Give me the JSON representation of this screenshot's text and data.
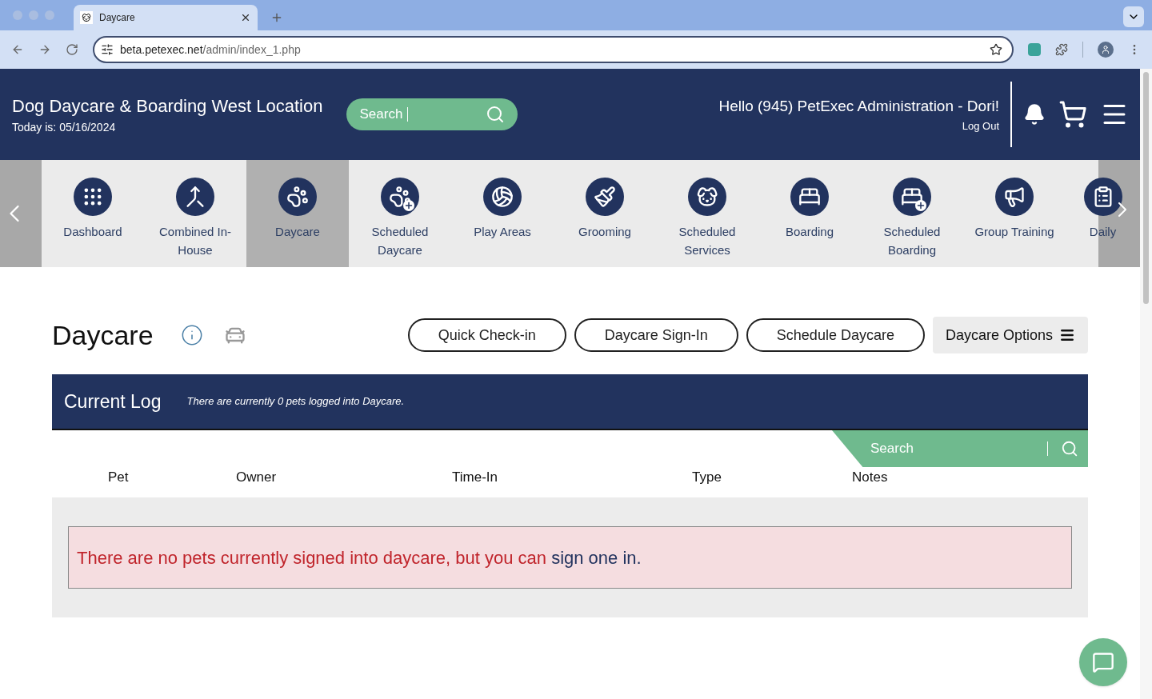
{
  "browser": {
    "tab_title": "Daycare",
    "url_host": "beta.petexec.net",
    "url_path": "/admin/index_1.php"
  },
  "header": {
    "title": "Dog Daycare & Boarding West Location",
    "date": "Today is: 05/16/2024",
    "search": {
      "placeholder": "Search"
    },
    "greeting": "Hello (945) PetExec Administration - Dori!",
    "logout": "Log Out"
  },
  "nav": [
    {
      "label": "Dashboard",
      "kind": "dashboard",
      "selected": false
    },
    {
      "label": "Combined In-House",
      "kind": "combined",
      "selected": false
    },
    {
      "label": "Daycare",
      "kind": "daycare",
      "selected": true
    },
    {
      "label": "Scheduled Daycare",
      "kind": "scheduled_daycare",
      "selected": false
    },
    {
      "label": "Play Areas",
      "kind": "play",
      "selected": false
    },
    {
      "label": "Grooming",
      "kind": "grooming",
      "selected": false
    },
    {
      "label": "Scheduled Services",
      "kind": "services",
      "selected": false
    },
    {
      "label": "Boarding",
      "kind": "boarding",
      "selected": false
    },
    {
      "label": "Scheduled Boarding",
      "kind": "scheduled_boarding",
      "selected": false
    },
    {
      "label": "Group Training",
      "kind": "training",
      "selected": false
    },
    {
      "label": "Daily",
      "kind": "daily",
      "selected": false
    }
  ],
  "page": {
    "title": "Daycare",
    "actions": [
      "Quick Check-in",
      "Daycare Sign-In",
      "Schedule Daycare"
    ],
    "options": "Daycare Options"
  },
  "log": {
    "title": "Current Log",
    "subtitle": "There are currently 0 pets logged into Daycare.",
    "search": {
      "placeholder": "Search"
    },
    "columns": [
      "Pet",
      "Owner",
      "Time-In",
      "Type",
      "Notes"
    ],
    "empty_message": "There are no pets currently signed into daycare, but you can",
    "empty_link": "sign one in."
  }
}
